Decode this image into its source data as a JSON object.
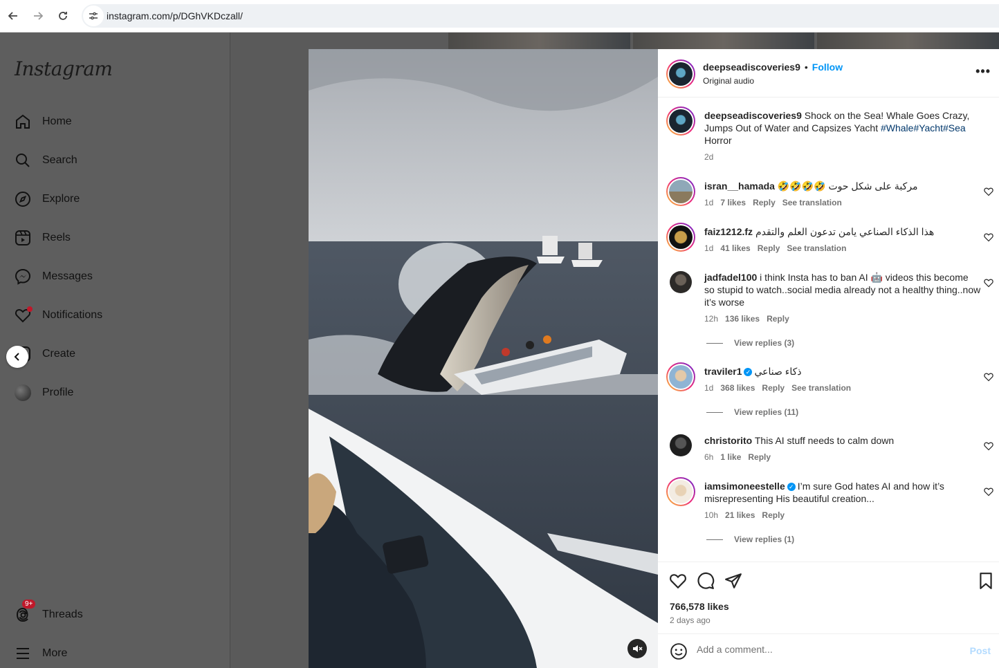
{
  "browser": {
    "url": "instagram.com/p/DGhVKDczall/",
    "back_icon": "arrow-left-icon",
    "forward_icon": "arrow-right-icon",
    "reload_icon": "reload-icon"
  },
  "sidebar": {
    "logo": "Instagram",
    "items": [
      {
        "label": "Home",
        "icon": "home-icon"
      },
      {
        "label": "Search",
        "icon": "search-icon"
      },
      {
        "label": "Explore",
        "icon": "compass-icon"
      },
      {
        "label": "Reels",
        "icon": "reels-icon"
      },
      {
        "label": "Messages",
        "icon": "messenger-icon"
      },
      {
        "label": "Notifications",
        "icon": "heart-icon"
      },
      {
        "label": "Create",
        "icon": "plus-square-icon"
      },
      {
        "label": "Profile",
        "icon": "avatar"
      },
      {
        "label": "Threads",
        "icon": "threads-icon",
        "badge": "9+"
      },
      {
        "label": "More",
        "icon": "menu-icon"
      }
    ]
  },
  "post": {
    "author": "deepseadiscoveries9",
    "follow_label": "Follow",
    "audio": "Original audio",
    "caption": "Shock on the Sea! Whale Goes Crazy, Jumps Out of Water and Capsizes Yacht",
    "hashtags": "#Whale#Yacht#Sea",
    "caption_end": "Horror",
    "caption_time": "2d",
    "likes": "766,578 likes",
    "posted": "2 days ago"
  },
  "comments": [
    {
      "user": "isran__hamada",
      "text": "🤣🤣🤣🤣 مركبة على شكل حوت",
      "time": "1d",
      "likes": "7 likes",
      "reply": "Reply",
      "translate": "See translation"
    },
    {
      "user": "faiz1212.fz",
      "text": "هذا الذكاء الصناعي يامن تدعون العلم والتقدم",
      "time": "1d",
      "likes": "41 likes",
      "reply": "Reply",
      "translate": "See translation"
    },
    {
      "user": "jadfadel100",
      "text": "i think Insta has to ban AI 🤖 videos this become so stupid to watch..social media already not a healthy thing..now it’s worse",
      "time": "12h",
      "likes": "136 likes",
      "reply": "Reply",
      "replies": "View replies (3)"
    },
    {
      "user": "traviler1",
      "verified": true,
      "text": "ذكاء صناعي",
      "time": "1d",
      "likes": "368 likes",
      "reply": "Reply",
      "translate": "See translation",
      "replies": "View replies (11)"
    },
    {
      "user": "christorito",
      "text": "This AI stuff needs to calm down",
      "time": "6h",
      "likes": "1 like",
      "reply": "Reply"
    },
    {
      "user": "iamsimoneestelle",
      "verified": true,
      "text": "I’m sure God hates AI and how it’s misrepresenting His beautiful creation...",
      "time": "10h",
      "likes": "21 likes",
      "reply": "Reply",
      "replies": "View replies (1)"
    }
  ],
  "compose": {
    "placeholder": "Add a comment...",
    "post_label": "Post"
  }
}
